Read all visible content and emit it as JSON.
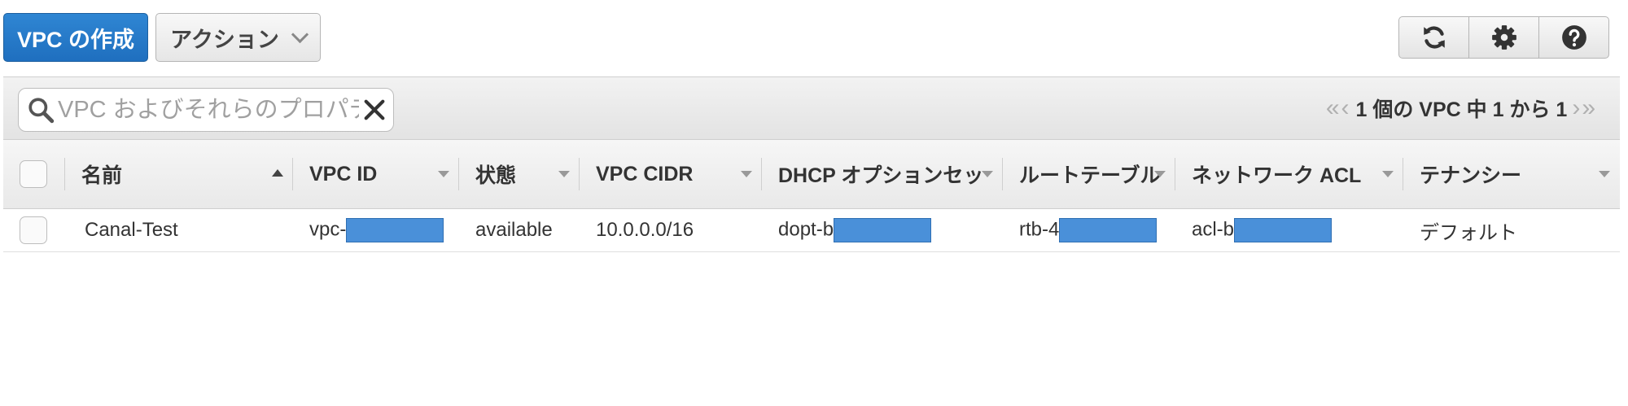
{
  "toolbar": {
    "create_vpc_label": "VPC の作成",
    "actions_label": "アクション",
    "icons": [
      "refresh-icon",
      "gear-icon",
      "help-icon"
    ]
  },
  "filter": {
    "placeholder": "VPC およびそれらのプロパティ",
    "value": ""
  },
  "pagination": {
    "text": "1 個の VPC 中 1 から 1"
  },
  "table": {
    "columns": [
      "名前",
      "VPC ID",
      "状態",
      "VPC CIDR",
      "DHCP オプションセッ",
      "ルートテーブル",
      "ネットワーク ACL",
      "テナンシー"
    ],
    "rows": [
      {
        "name": "Canal-Test",
        "vpc_id": "vpc-",
        "status": "available",
        "cidr": "10.0.0.0/16",
        "dhcp": "dopt-b",
        "route_table": "rtb-4",
        "acl": "acl-b",
        "tenancy": "デフォルト"
      }
    ]
  },
  "colors": {
    "primary": "#1f6fbf",
    "status_available": "#1d8f2f",
    "redaction": "#4a90d9"
  }
}
